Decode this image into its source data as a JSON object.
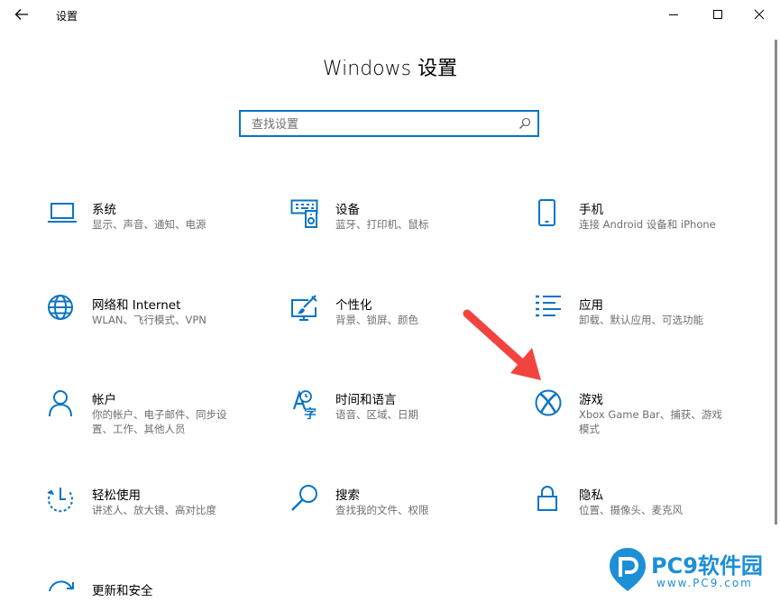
{
  "window": {
    "app_title": "设置",
    "accent": "#0a74c4"
  },
  "page": {
    "title": "Windows 设置"
  },
  "search": {
    "placeholder": "查找设置"
  },
  "tiles": [
    {
      "icon": "laptop-icon",
      "name": "系统",
      "desc": "显示、声音、通知、电源"
    },
    {
      "icon": "keyboard-speaker-icon",
      "name": "设备",
      "desc": "蓝牙、打印机、鼠标"
    },
    {
      "icon": "phone-icon",
      "name": "手机",
      "desc": "连接 Android 设备和 iPhone"
    },
    {
      "icon": "globe-icon",
      "name": "网络和 Internet",
      "desc": "WLAN、飞行模式、VPN"
    },
    {
      "icon": "paint-icon",
      "name": "个性化",
      "desc": "背景、锁屏、颜色"
    },
    {
      "icon": "apps-list-icon",
      "name": "应用",
      "desc": "卸载、默认应用、可选功能"
    },
    {
      "icon": "person-icon",
      "name": "帐户",
      "desc": "你的帐户、电子邮件、同步设置、工作、其他人员"
    },
    {
      "icon": "time-language-icon",
      "name": "时间和语言",
      "desc": "语音、区域、日期"
    },
    {
      "icon": "xbox-icon",
      "name": "游戏",
      "desc": "Xbox Game Bar、捕获、游戏模式"
    },
    {
      "icon": "ease-of-access-icon",
      "name": "轻松使用",
      "desc": "讲述人、放大镜、高对比度"
    },
    {
      "icon": "search-magnifier-icon",
      "name": "搜索",
      "desc": "查找我的文件、权限"
    },
    {
      "icon": "lock-icon",
      "name": "隐私",
      "desc": "位置、摄像头、麦克风"
    },
    {
      "icon": "update-icon",
      "name": "更新和安全",
      "desc": ""
    }
  ],
  "watermark": {
    "brand": "PC9软件园",
    "site": "www.PC9.com"
  }
}
